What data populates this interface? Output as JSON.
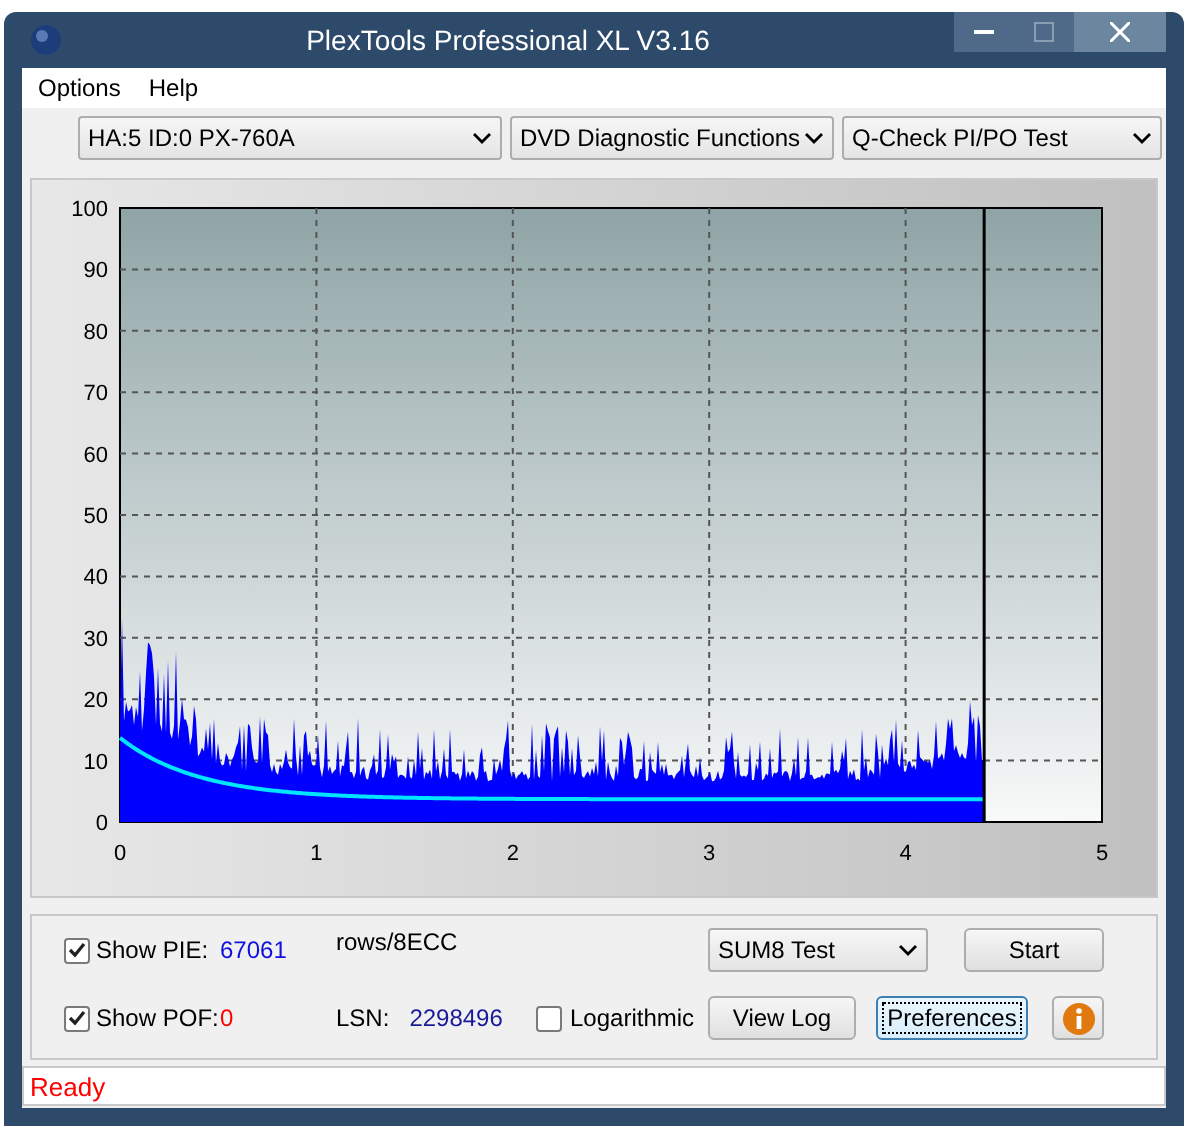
{
  "window": {
    "title": "PlexTools Professional XL V3.16"
  },
  "menu": [
    {
      "label": "Options"
    },
    {
      "label": "Help"
    }
  ],
  "toolbar": [
    {
      "value": "HA:5 ID:0  PX-760A"
    },
    {
      "value": "DVD Diagnostic Functions"
    },
    {
      "value": "Q-Check PI/PO Test"
    }
  ],
  "chart": {
    "y_labels": [
      "100",
      "90",
      "80",
      "70",
      "60",
      "50",
      "40",
      "30",
      "20",
      "10",
      "0"
    ],
    "x_labels": [
      "0",
      "1",
      "2",
      "3",
      "4",
      "5"
    ]
  },
  "show_pie": {
    "label": "Show PIE:",
    "checked": true,
    "value": "67061",
    "unit": "rows/8ECC"
  },
  "show_pof": {
    "label": "Show POF:",
    "checked": true,
    "value": "0"
  },
  "lsn": {
    "label": "LSN:",
    "value": "2298496"
  },
  "logarithmic": {
    "label": "Logarithmic",
    "checked": false
  },
  "test_select": {
    "value": "SUM8 Test"
  },
  "buttons": [
    {
      "label": "Start",
      "focused": false
    },
    {
      "label": "View Log",
      "focused": false
    },
    {
      "label": "Preferences",
      "focused": true
    }
  ],
  "status": "Ready"
}
